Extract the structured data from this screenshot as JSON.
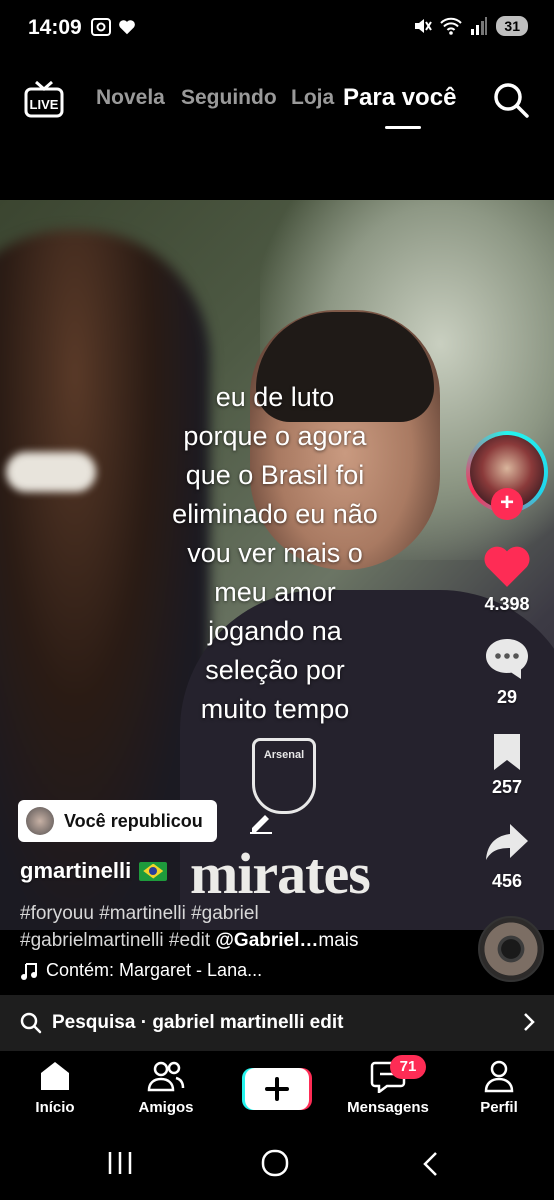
{
  "status_bar": {
    "time": "14:09",
    "battery": "31"
  },
  "top_nav": {
    "live_label": "LIVE",
    "tabs": [
      {
        "label": "Novela"
      },
      {
        "label": "Seguindo"
      },
      {
        "label": "Loja"
      },
      {
        "label": "Para você"
      }
    ],
    "active_tab": "Para você"
  },
  "video": {
    "caption": "eu de luto porque o agora que o Brasil foi eliminado eu não vou ver mais o meu amor jogando na seleção por muito tempo",
    "caption_lines": [
      "eu de luto",
      "porque o agora",
      "que o Brasil foi",
      "eliminado eu não",
      "vou ver mais o",
      "meu amor",
      "jogando na",
      "seleção por",
      "muito tempo"
    ],
    "sponsor_text": "mirates",
    "crest_text": "Arsenal"
  },
  "sidebar": {
    "likes": "4.398",
    "comments": "29",
    "saves": "257",
    "shares": "456",
    "follow_symbol": "+"
  },
  "post": {
    "repost_label": "Você republicou",
    "username": "gmartinelli",
    "description_line1": "#foryouu #martinelli #gabriel",
    "description_line2_tags": "#gabrielmartinelli #edit ",
    "description_mention": "@Gabriel…",
    "description_more": "mais",
    "music": "Contém: Margaret - Lana..."
  },
  "search_suggestion": {
    "label": "Pesquisa · gabriel martinelli edit"
  },
  "bottom_nav": {
    "items": [
      {
        "label": "Início"
      },
      {
        "label": "Amigos"
      },
      {
        "label": ""
      },
      {
        "label": "Mensagens"
      },
      {
        "label": "Perfil"
      }
    ],
    "messages_badge": "71"
  },
  "colors": {
    "accent": "#fe2c55",
    "cyan": "#25f4ee",
    "search_bar_bg": "#1e1e1e"
  }
}
